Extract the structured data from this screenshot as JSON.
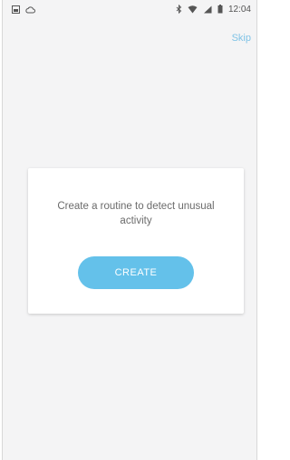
{
  "status_bar": {
    "time": "12:04",
    "icons_left": [
      "image-icon",
      "cloud-icon"
    ],
    "icons_right": [
      "bluetooth-icon",
      "wifi-icon",
      "signal-icon",
      "battery-icon"
    ]
  },
  "header": {
    "skip_label": "Skip"
  },
  "card": {
    "message": "Create a routine to detect unusual activity",
    "button_label": "CREATE"
  },
  "colors": {
    "accent": "#64c1ea",
    "skip_text": "#7fc3e6",
    "background": "#f4f4f5"
  }
}
